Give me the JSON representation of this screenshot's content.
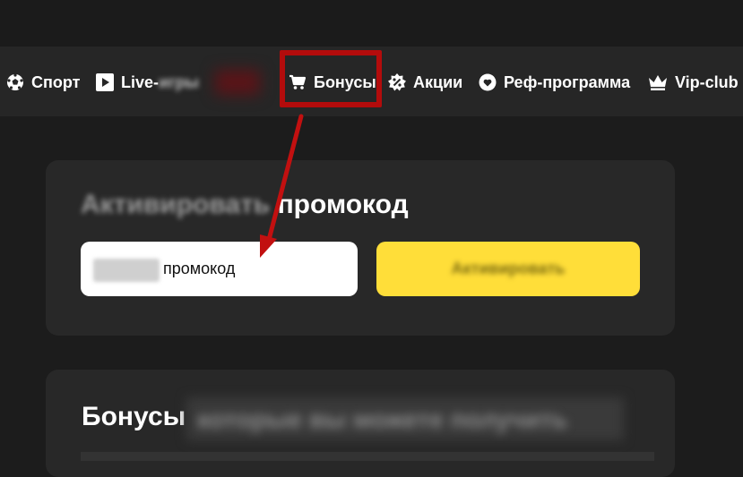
{
  "nav": {
    "sport": "Спорт",
    "live": "Live-",
    "live_blurred": "игры",
    "bonuses": "Бонусы",
    "promos": "Акции",
    "referral": "Реф-программа",
    "vip": "Vip-club"
  },
  "promo_card": {
    "title_blurred": "Активировать",
    "title": "промокод",
    "input_value": "промокод",
    "activate_label": "Активировать"
  },
  "bonus_card": {
    "title": "Бонусы",
    "title_blurred": "которые вы можете получить"
  },
  "colors": {
    "accent_yellow": "#ffde39",
    "highlight_red": "#b30c0c",
    "background": "#1c1c1c",
    "card": "#282828"
  },
  "icons": [
    "soccer-ball-icon",
    "play-icon",
    "cart-icon",
    "percent-badge-icon",
    "refresh-heart-icon",
    "crown-icon"
  ]
}
